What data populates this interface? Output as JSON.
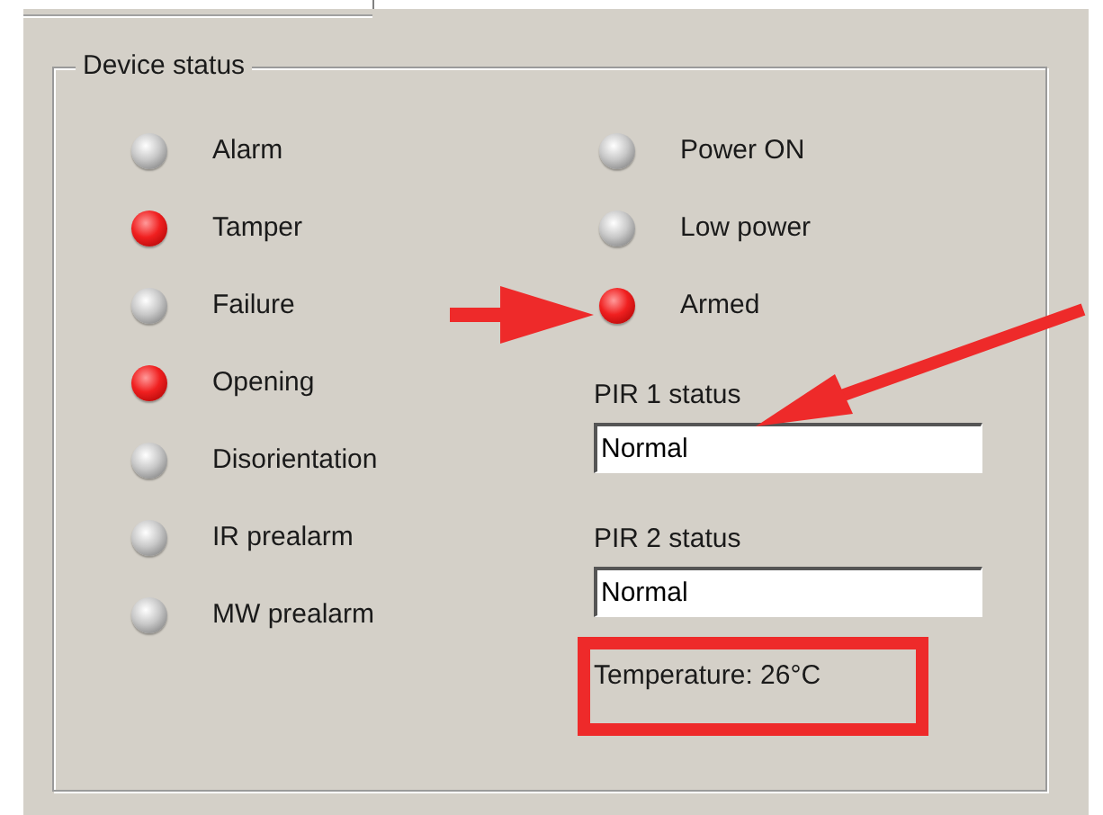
{
  "group": {
    "title": "Device status"
  },
  "left_indicators": [
    {
      "label": "Alarm",
      "on": false
    },
    {
      "label": "Tamper",
      "on": true
    },
    {
      "label": "Failure",
      "on": false
    },
    {
      "label": "Opening",
      "on": true
    },
    {
      "label": "Disorientation",
      "on": false
    },
    {
      "label": "IR prealarm",
      "on": false
    },
    {
      "label": "MW prealarm",
      "on": false
    }
  ],
  "right_indicators": [
    {
      "label": "Power ON",
      "on": false
    },
    {
      "label": "Low power",
      "on": false
    },
    {
      "label": "Armed",
      "on": true
    }
  ],
  "fields": [
    {
      "label": "PIR 1 status",
      "value": "Normal"
    },
    {
      "label": "PIR 2 status",
      "value": "Normal"
    }
  ],
  "temperature": "Temperature: 26°C"
}
